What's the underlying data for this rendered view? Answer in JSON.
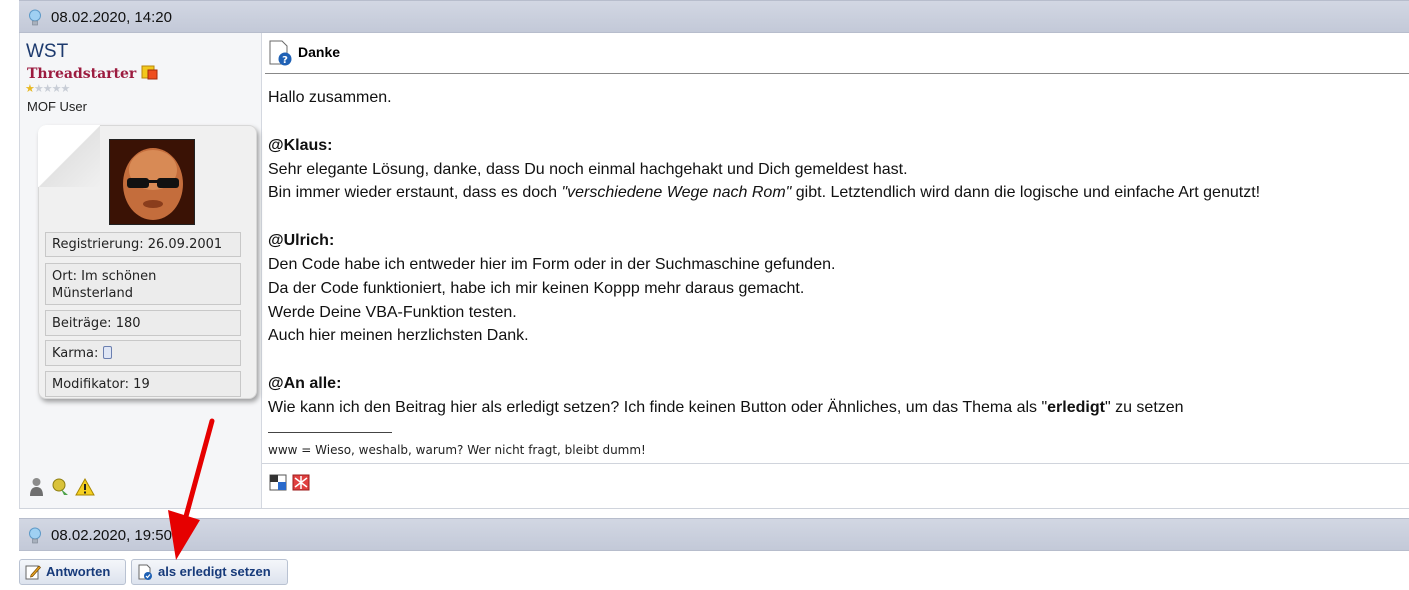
{
  "post1": {
    "date": "08.02.2020, 14:20",
    "user": {
      "name": "WST",
      "title": "Threadstarter",
      "rank": "MOF User",
      "stars_filled": 1,
      "stars_total": 5
    },
    "profile": {
      "registered": "Registrierung: 26.09.2001",
      "location": "Ort: Im schönen Münsterland",
      "posts": "Beiträge: 180",
      "karma": "Karma:",
      "modifier": "Modifikator: 19"
    },
    "title": "Danke",
    "lines": {
      "l1": "Hallo zusammen.",
      "h_klaus": "@Klaus:",
      "k1": "Sehr elegante Lösung, danke, dass Du noch einmal hachgehakt und Dich gemeldest hast.",
      "k2a": "Bin immer wieder erstaunt, dass es doch ",
      "k2b": "\"verschiedene Wege nach Rom\"",
      "k2c": " gibt. Letztendlich wird dann die logische und einfache Art genutzt!",
      "h_ulrich": "@Ulrich:",
      "u1": "Den Code habe ich entweder hier im Form oder in der Suchmaschine gefunden.",
      "u2": "Da der Code funktioniert, habe ich mir keinen Koppp mehr daraus gemacht.",
      "u3": "Werde Deine VBA-Funktion testen.",
      "u4": "Auch hier meinen herzlichsten Dank.",
      "h_all": "@An alle:",
      "a1a": "Wie kann ich den Beitrag hier als erledigt setzen? Ich finde keinen Button oder Ähnliches, um das Thema als \"",
      "a1b": "erledigt",
      "a1c": "\" zu setzen"
    },
    "signature": "www = Wieso, weshalb, warum? Wer nicht fragt, bleibt dumm!"
  },
  "post2": {
    "date": "08.02.2020, 19:50"
  },
  "buttons": {
    "reply": "Antworten",
    "mark_done": "als erledigt setzen"
  },
  "icons": [
    "bulb-icon",
    "document-question-icon",
    "user-icon",
    "award-icon",
    "warning-icon",
    "pencil-icon",
    "done-icon"
  ],
  "colors": {
    "username": "#1d3a6e",
    "usertitle": "#9c1b3f",
    "arrow": "#e60000"
  }
}
